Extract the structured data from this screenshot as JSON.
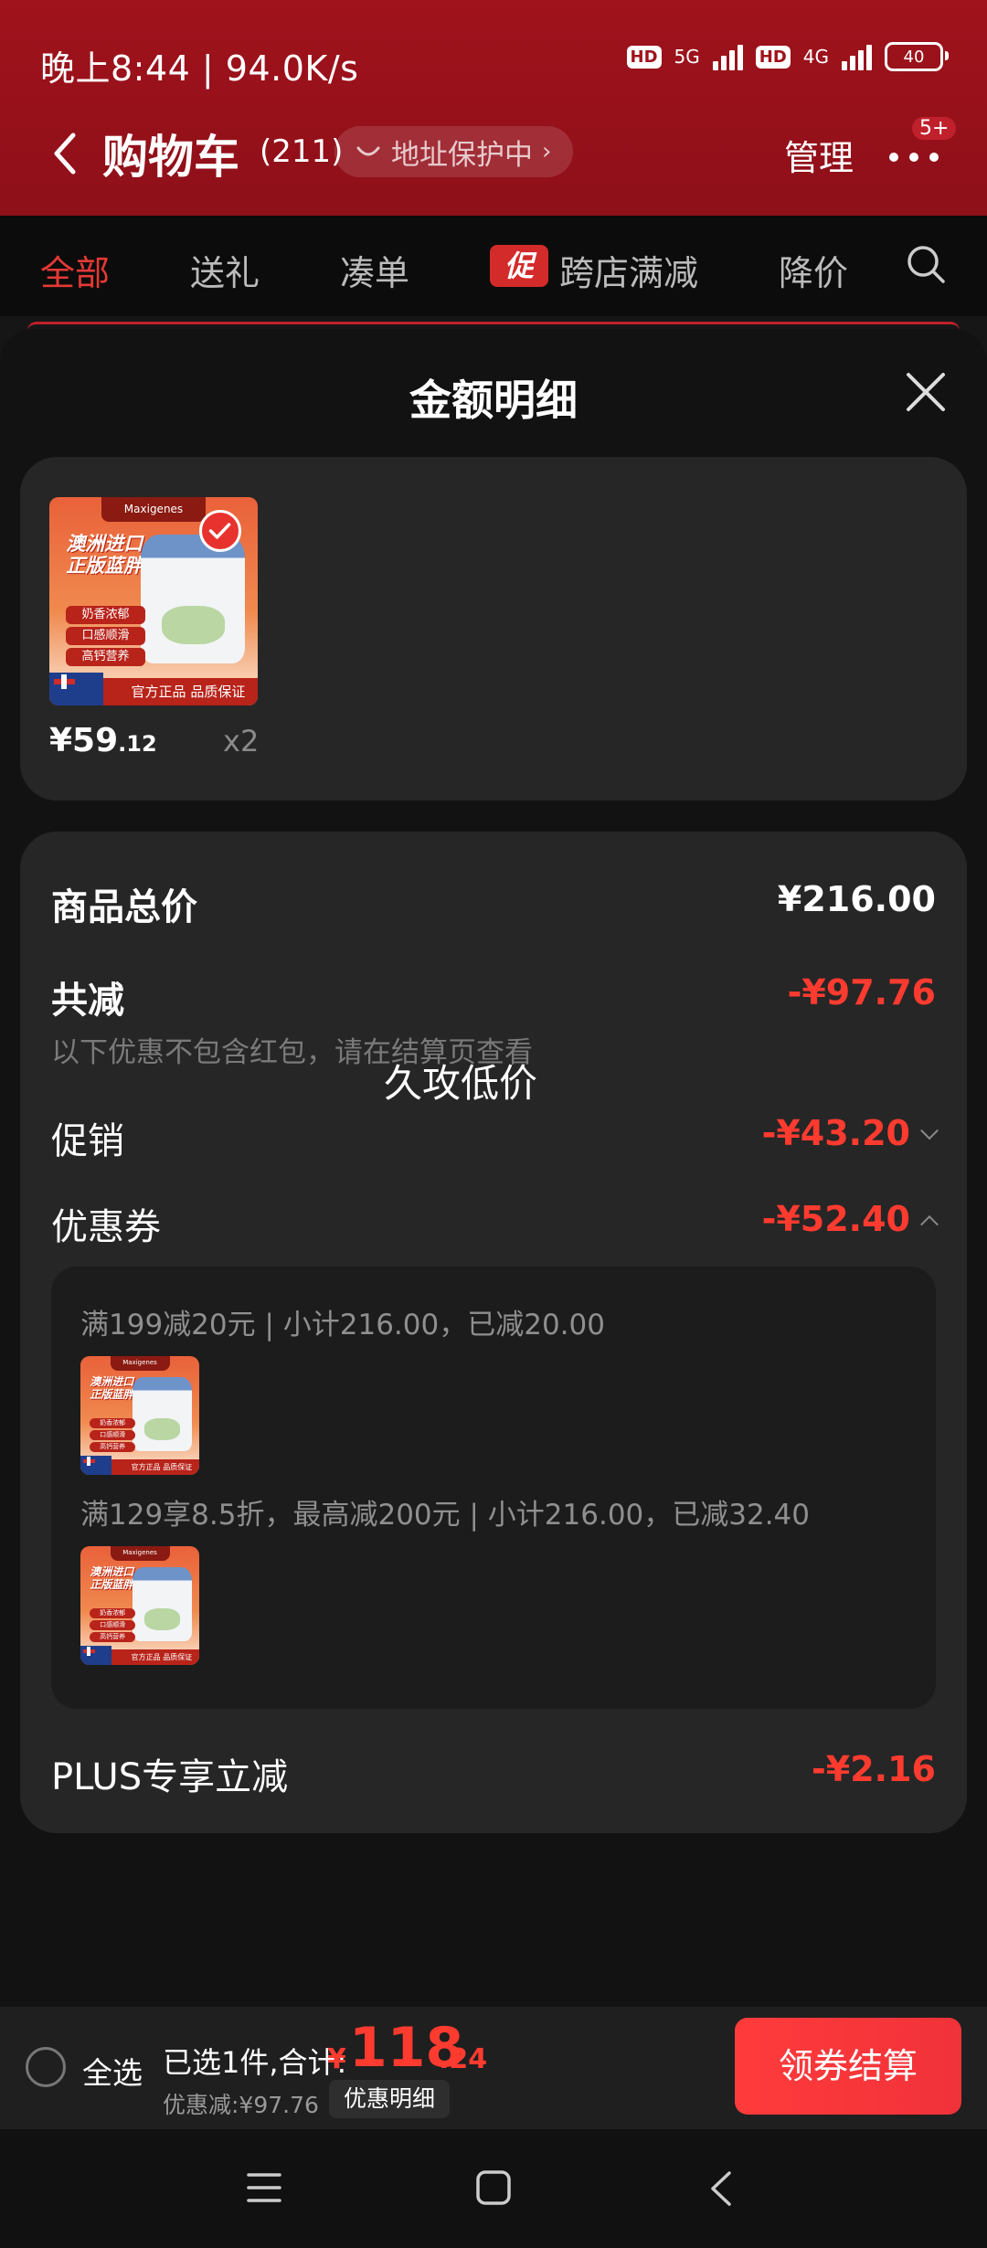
{
  "status_bar": {
    "time": "晚上8:44 | 94.0K/s",
    "network_1": "5G",
    "network_2": "4G",
    "hd": "HD",
    "battery": "40"
  },
  "header": {
    "title": "购物车",
    "count": "(211)",
    "address_protection": "地址保护中",
    "manage": "管理",
    "more_badge": "5+"
  },
  "tabs": [
    {
      "label": "全部",
      "active": true
    },
    {
      "label": "送礼"
    },
    {
      "label": "凑单"
    },
    {
      "label": "跨店满减",
      "badge": "促"
    },
    {
      "label": "降价"
    }
  ],
  "sheet": {
    "title": "金额明细"
  },
  "product": {
    "brand": "Maxigenes",
    "headline_1": "澳洲进口",
    "headline_2": "正版蓝胖子",
    "tags": [
      "奶香浓郁",
      "口感顺滑",
      "高钙营养"
    ],
    "footer": "官方正品 品质保证",
    "price_int": "¥59",
    "price_dec": ".12",
    "quantity": "x2"
  },
  "breakdown": {
    "total_label": "商品总价",
    "total_value": "¥216.00",
    "discount_label": "共减",
    "discount_value": "-¥97.76",
    "note": "以下优惠不包含红包，请在结算页查看",
    "overlay_text": "久攻低价",
    "promo_label": "促销",
    "promo_value": "-¥43.20",
    "coupon_label": "优惠券",
    "coupon_value": "-¥52.40",
    "coupon_lines": [
      "满199减20元 | 小计216.00，已减20.00",
      "满129享8.5折，最高减200元 | 小计216.00，已减32.40"
    ],
    "plus_label": "PLUS专享立减",
    "plus_value": "-¥2.16"
  },
  "bottom_bar": {
    "select_all": "全选",
    "summary_label": "已选1件,合计:",
    "currency": "¥",
    "amount_int": "118",
    "amount_dec": ".24",
    "discount_text": "优惠减:¥97.76",
    "detail_button": "优惠明细",
    "checkout_button": "领券结算"
  },
  "colors": {
    "header_red": "#a0121c",
    "accent_red": "#ff3b30",
    "card_bg": "#262626"
  }
}
